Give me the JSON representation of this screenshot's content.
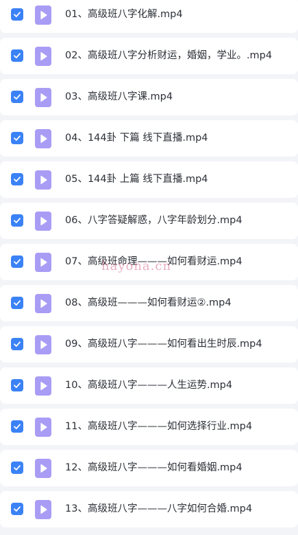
{
  "colors": {
    "background": "#f3f4f8",
    "row": "#ffffff",
    "checkbox": "#3b82f6",
    "file_icon": "#a99cf5",
    "text": "#2b2f36",
    "watermark": "#d66e8c"
  },
  "icons": {
    "checkbox": "checkmark-icon",
    "file": "video-file-play-icon"
  },
  "files": [
    {
      "name": "01、高级班八字化解.mp4",
      "checked": true
    },
    {
      "name": "02、高级班八字分析财运，婚姻，学业。.mp4",
      "checked": true
    },
    {
      "name": "03、高级班八字课.mp4",
      "checked": true
    },
    {
      "name": "04、144卦 下篇 线下直播.mp4",
      "checked": true
    },
    {
      "name": "05、144卦 上篇 线下直播.mp4",
      "checked": true
    },
    {
      "name": "06、八字答疑解惑，八字年龄划分.mp4",
      "checked": true
    },
    {
      "name": "07、高级班命理———如何看财运.mp4",
      "checked": true
    },
    {
      "name": "08、高级班———如何看财运②.mp4",
      "checked": true
    },
    {
      "name": "09、高级班八字———如何看出生时辰.mp4",
      "checked": true
    },
    {
      "name": "10、高级班八字———人生运势.mp4",
      "checked": true
    },
    {
      "name": "11、高级班八字———如何选择行业.mp4",
      "checked": true
    },
    {
      "name": "12、高级班八字———如何看婚姻.mp4",
      "checked": true
    },
    {
      "name": "13、高级班八字———八字如何合婚.mp4",
      "checked": true
    }
  ],
  "watermark": "hayona.cn"
}
